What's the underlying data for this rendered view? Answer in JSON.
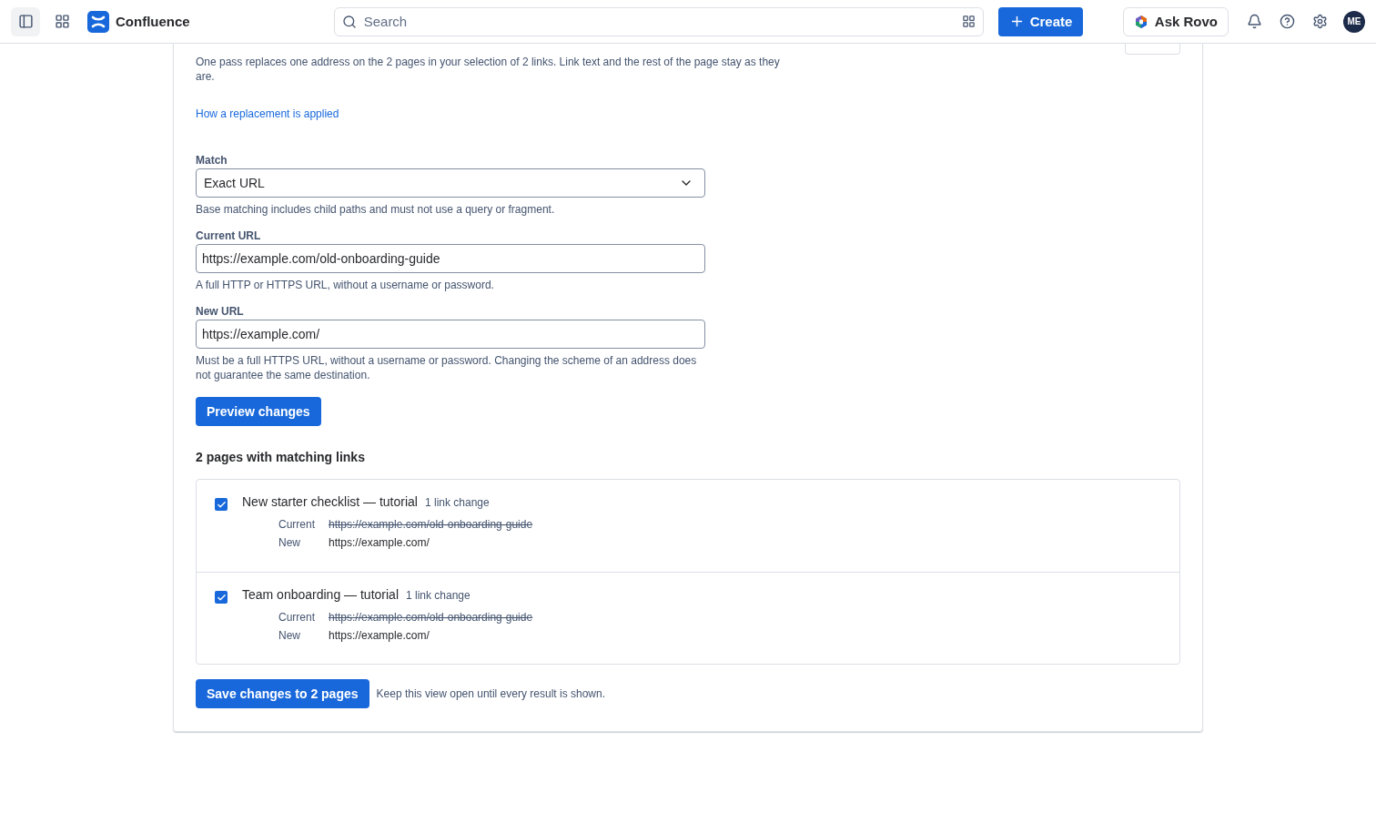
{
  "header": {
    "product": "Confluence",
    "search": {
      "placeholder": "Search"
    },
    "create_button": "Create",
    "ask_button": "Ask Rovo",
    "avatar": "ME"
  },
  "intro": "One pass replaces one address on the 2 pages in your selection of 2 links. Link text and the rest of the page stay as they are.",
  "help_link": "How a replacement is applied",
  "fields": [
    {
      "kind": "select",
      "label": "Match",
      "value": "Exact URL",
      "help": "Base matching includes child paths and must not use a query or fragment."
    },
    {
      "kind": "text",
      "label": "Current URL",
      "value": "https://example.com/old-onboarding-guide",
      "help": "A full HTTP or HTTPS URL, without a username or password."
    },
    {
      "kind": "text",
      "label": "New URL",
      "value": "https://example.com/",
      "help": "Must be a full HTTPS URL, without a username or password. Changing the scheme of an address does not guarantee the same destination."
    }
  ],
  "preview_button": "Preview changes",
  "results": {
    "heading": "2 pages with matching links",
    "pages": [
      {
        "title": "New starter checklist — tutorial",
        "count": "1 link change",
        "checked": true,
        "current_label": "Current",
        "current": "https://example.com/old-onboarding-guide",
        "new_label": "New",
        "new": "https://example.com/"
      },
      {
        "title": "Team onboarding — tutorial",
        "count": "1 link change",
        "checked": true,
        "current_label": "Current",
        "current": "https://example.com/old-onboarding-guide",
        "new_label": "New",
        "new": "https://example.com/"
      }
    ]
  },
  "save_button": "Save changes to 2 pages",
  "save_note": "Keep this view open until every result is shown."
}
